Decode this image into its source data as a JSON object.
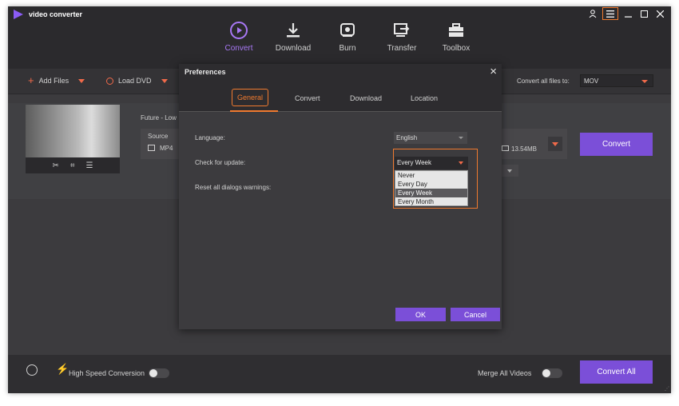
{
  "app": {
    "title": "video converter",
    "logo_icon": "play-logo-icon"
  },
  "window_controls": {
    "user_icon": "user-icon",
    "menu_icon": "menu-icon",
    "min_icon": "minimize-icon",
    "max_icon": "maximize-icon",
    "close_icon": "close-icon"
  },
  "nav": {
    "tabs": [
      {
        "label": "Convert",
        "icon": "convert-icon",
        "active": true
      },
      {
        "label": "Download",
        "icon": "download-icon"
      },
      {
        "label": "Burn",
        "icon": "burn-icon"
      },
      {
        "label": "Transfer",
        "icon": "transfer-icon"
      },
      {
        "label": "Toolbox",
        "icon": "toolbox-icon"
      }
    ]
  },
  "toolbar": {
    "add_files": "Add Files",
    "load_dvd": "Load DVD",
    "convert_all_files_to": "Convert all files to:",
    "format": "MOV"
  },
  "file": {
    "title": "Future - Low",
    "source_label": "Source",
    "format": "MP4",
    "size": "13.54MB",
    "convert_label": "Convert"
  },
  "bottom": {
    "high_speed_label": "High Speed Conversion",
    "merge_label": "Merge All Videos",
    "convert_all_label": "Convert All"
  },
  "preferences": {
    "title": "Preferences",
    "tabs": [
      "General",
      "Convert",
      "Download",
      "Location"
    ],
    "active_tab": "General",
    "language_label": "Language:",
    "language_value": "English",
    "check_update_label": "Check for update:",
    "check_update_value": "Every Week",
    "check_update_options": [
      "Never",
      "Every Day",
      "Every Week",
      "Every Month"
    ],
    "reset_warnings_label": "Reset all dialogs warnings:",
    "ok_label": "OK",
    "cancel_label": "Cancel"
  },
  "colors": {
    "accent": "#7b4fd8",
    "highlight": "#f07a2f",
    "bg": "#3a3a3c"
  }
}
